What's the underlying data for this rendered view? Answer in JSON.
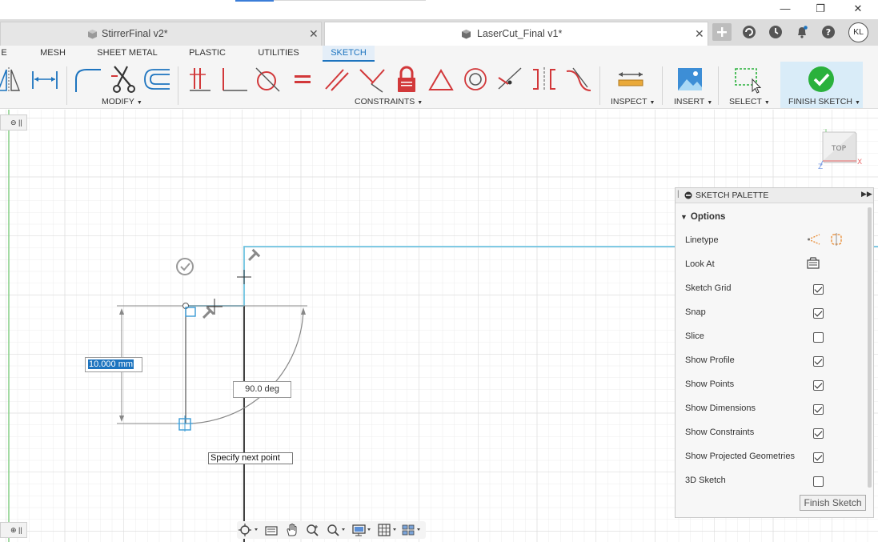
{
  "window": {
    "minimize_glyph": "—",
    "restore_glyph": "❐",
    "close_glyph": "✕"
  },
  "tabs": [
    {
      "label": "StirrerFinal v2*",
      "active": false,
      "close_glyph": "✕"
    },
    {
      "label": "LaserCut_Final v1*",
      "active": true,
      "close_glyph": "✕"
    }
  ],
  "header_icons": [
    "new-tab-plus-icon",
    "extensions-icon",
    "job-status-icon",
    "notifications-icon",
    "help-icon"
  ],
  "user": {
    "initials": "KL"
  },
  "ribbon_tabs": [
    {
      "label": "E"
    },
    {
      "label": "MESH"
    },
    {
      "label": "SHEET METAL"
    },
    {
      "label": "PLASTIC"
    },
    {
      "label": "UTILITIES"
    },
    {
      "label": "SKETCH",
      "active": true
    }
  ],
  "ribbon_groups": {
    "modify": "MODIFY",
    "constraints": "CONSTRAINTS",
    "inspect": "INSPECT",
    "insert": "INSERT",
    "select": "SELECT",
    "finish": "FINISH SKETCH"
  },
  "canvas": {
    "dimension_value": "10.000 mm",
    "angle_value": "90.0 deg",
    "tooltip": "Specify next point",
    "viewcube_face": "TOP",
    "axis_x": "X",
    "axis_z": "Z",
    "axis_y": "Y"
  },
  "palette": {
    "title": "SKETCH PALETTE",
    "section": "Options",
    "rows": [
      {
        "label": "Linetype",
        "kind": "icons"
      },
      {
        "label": "Look At",
        "kind": "icon"
      },
      {
        "label": "Sketch Grid",
        "checked": true
      },
      {
        "label": "Snap",
        "checked": true
      },
      {
        "label": "Slice",
        "checked": false
      },
      {
        "label": "Show Profile",
        "checked": true
      },
      {
        "label": "Show Points",
        "checked": true
      },
      {
        "label": "Show Dimensions",
        "checked": true
      },
      {
        "label": "Show Constraints",
        "checked": true
      },
      {
        "label": "Show Projected Geometries",
        "checked": true
      },
      {
        "label": "3D Sketch",
        "checked": false
      }
    ],
    "finish_button": "Finish Sketch"
  },
  "colors": {
    "accent_blue": "#1d74bf",
    "sketch_line": "#6fc3e0",
    "finish_green": "#2ab13c",
    "constraint_red": "#d2383a"
  }
}
